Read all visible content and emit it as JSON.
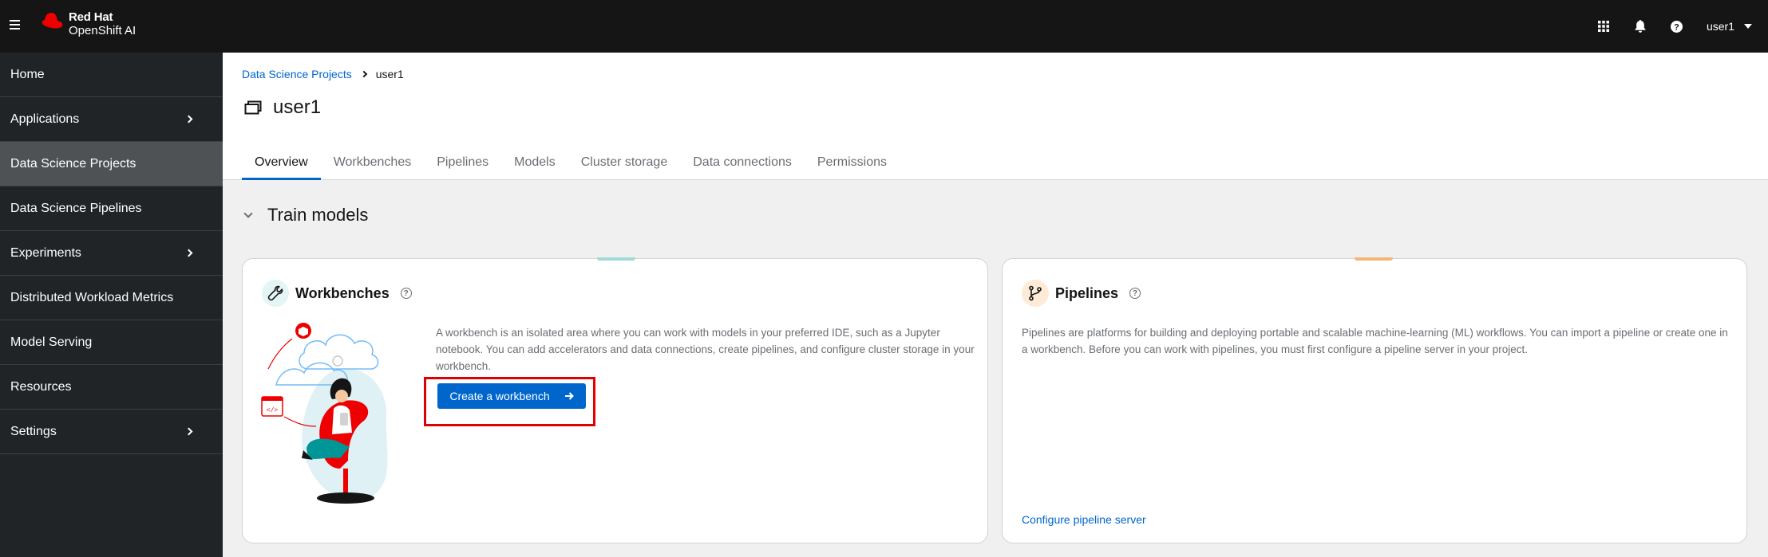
{
  "masthead": {
    "brand_line1": "Red Hat",
    "brand_line2": "OpenShift AI",
    "icons": [
      "app-launcher-icon",
      "bell-icon",
      "help-icon"
    ],
    "user": "user1"
  },
  "sidebar": {
    "items": [
      {
        "label": "Home",
        "expandable": false,
        "active": false
      },
      {
        "label": "Applications",
        "expandable": true,
        "active": false
      },
      {
        "label": "Data Science Projects",
        "expandable": false,
        "active": true
      },
      {
        "label": "Data Science Pipelines",
        "expandable": false,
        "active": false
      },
      {
        "label": "Experiments",
        "expandable": true,
        "active": false
      },
      {
        "label": "Distributed Workload Metrics",
        "expandable": false,
        "active": false
      },
      {
        "label": "Model Serving",
        "expandable": false,
        "active": false
      },
      {
        "label": "Resources",
        "expandable": false,
        "active": false
      },
      {
        "label": "Settings",
        "expandable": true,
        "active": false
      }
    ]
  },
  "breadcrumb": {
    "parent": "Data Science Projects",
    "current": "user1"
  },
  "page": {
    "title": "user1"
  },
  "tabs": [
    "Overview",
    "Workbenches",
    "Pipelines",
    "Models",
    "Cluster storage",
    "Data connections",
    "Permissions"
  ],
  "active_tab": "Overview",
  "section": {
    "title": "Train models"
  },
  "workbenches_card": {
    "title": "Workbenches",
    "description": "A workbench is an isolated area where you can work with models in your preferred IDE, such as a Jupyter notebook. You can add accelerators and data connections, create pipelines, and configure cluster storage in your workbench.",
    "button_label": "Create a workbench",
    "accent_color": "#a2d9d9"
  },
  "pipelines_card": {
    "title": "Pipelines",
    "description": "Pipelines are platforms for building and deploying portable and scalable machine-learning (ML) workflows. You can import a pipeline or create one in a workbench. Before you can work with pipelines, you must first configure a pipeline server in your project.",
    "link_label": "Configure pipeline server",
    "accent_color": "#f4b678"
  },
  "colors": {
    "brand_red": "#ee0000",
    "link_blue": "#0066cc",
    "highlight_red": "#e00000"
  }
}
